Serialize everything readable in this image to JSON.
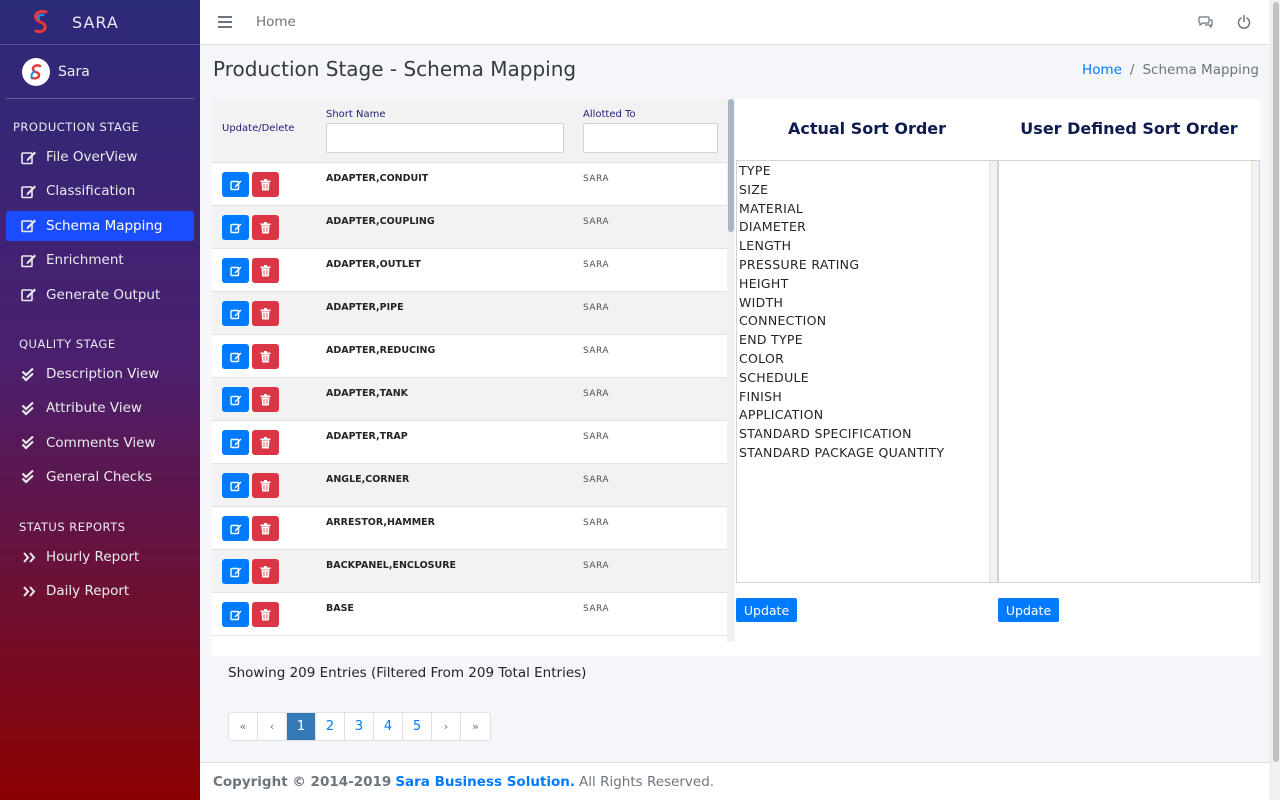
{
  "brand": {
    "name": "SARA"
  },
  "user": {
    "name": "Sara"
  },
  "sidebar": {
    "sections": [
      {
        "header": "PRODUCTION STAGE",
        "items": [
          {
            "label": "File OverView",
            "icon": "edit-icon"
          },
          {
            "label": "Classification",
            "icon": "edit-icon"
          },
          {
            "label": "Schema Mapping",
            "icon": "edit-icon",
            "active": true
          },
          {
            "label": "Enrichment",
            "icon": "edit-icon"
          },
          {
            "label": "Generate Output",
            "icon": "edit-icon"
          }
        ]
      },
      {
        "header": "QUALITY STAGE",
        "items": [
          {
            "label": "Description View",
            "icon": "double-check-icon"
          },
          {
            "label": "Attribute View",
            "icon": "double-check-icon"
          },
          {
            "label": "Comments View",
            "icon": "double-check-icon"
          },
          {
            "label": "General Checks",
            "icon": "double-check-icon"
          }
        ]
      },
      {
        "header": "STATUS REPORTS",
        "items": [
          {
            "label": "Hourly Report",
            "icon": "double-chevron-right-icon"
          },
          {
            "label": "Daily Report",
            "icon": "double-chevron-right-icon"
          }
        ]
      }
    ]
  },
  "topbar": {
    "home": "Home"
  },
  "page": {
    "title": "Production Stage - Schema Mapping",
    "breadcrumb": {
      "home": "Home",
      "separator": "/",
      "current": "Schema Mapping"
    }
  },
  "table": {
    "headers": {
      "actions": "Update/Delete",
      "short_name": "Short Name",
      "allotted_to": "Allotted To"
    },
    "rows": [
      {
        "short_name": "ADAPTER,CONDUIT",
        "allotted_to": "SARA"
      },
      {
        "short_name": "ADAPTER,COUPLING",
        "allotted_to": "SARA"
      },
      {
        "short_name": "ADAPTER,OUTLET",
        "allotted_to": "SARA"
      },
      {
        "short_name": "ADAPTER,PIPE",
        "allotted_to": "SARA"
      },
      {
        "short_name": "ADAPTER,REDUCING",
        "allotted_to": "SARA"
      },
      {
        "short_name": "ADAPTER,TANK",
        "allotted_to": "SARA"
      },
      {
        "short_name": "ADAPTER,TRAP",
        "allotted_to": "SARA"
      },
      {
        "short_name": "ANGLE,CORNER",
        "allotted_to": "SARA"
      },
      {
        "short_name": "ARRESTOR,HAMMER",
        "allotted_to": "SARA"
      },
      {
        "short_name": "BACKPANEL,ENCLOSURE",
        "allotted_to": "SARA"
      },
      {
        "short_name": "BASE",
        "allotted_to": "SARA"
      }
    ]
  },
  "sort": {
    "actual_title": "Actual Sort Order",
    "user_title": "User Defined Sort Order",
    "actual_items": [
      "TYPE",
      "SIZE",
      "MATERIAL",
      "DIAMETER",
      "LENGTH",
      "PRESSURE RATING",
      "HEIGHT",
      "WIDTH",
      "CONNECTION",
      "END TYPE",
      "COLOR",
      "SCHEDULE",
      "FINISH",
      "APPLICATION",
      "STANDARD SPECIFICATION",
      "STANDARD PACKAGE QUANTITY"
    ],
    "user_items": [],
    "update_label": "Update"
  },
  "showing": "Showing 209 Entries (Filtered From 209 Total Entries)",
  "pagination": {
    "first": "«",
    "prev": "‹",
    "pages": [
      "1",
      "2",
      "3",
      "4",
      "5"
    ],
    "current": "1",
    "next": "›",
    "last": "»"
  },
  "footer": {
    "prefix": "Copyright © 2014-2019",
    "company": "Sara Business Solution.",
    "suffix": "All Rights Reserved."
  },
  "colors": {
    "accent": "#007bff",
    "active_nav": "#1a4dff",
    "delete": "#dc3545"
  }
}
